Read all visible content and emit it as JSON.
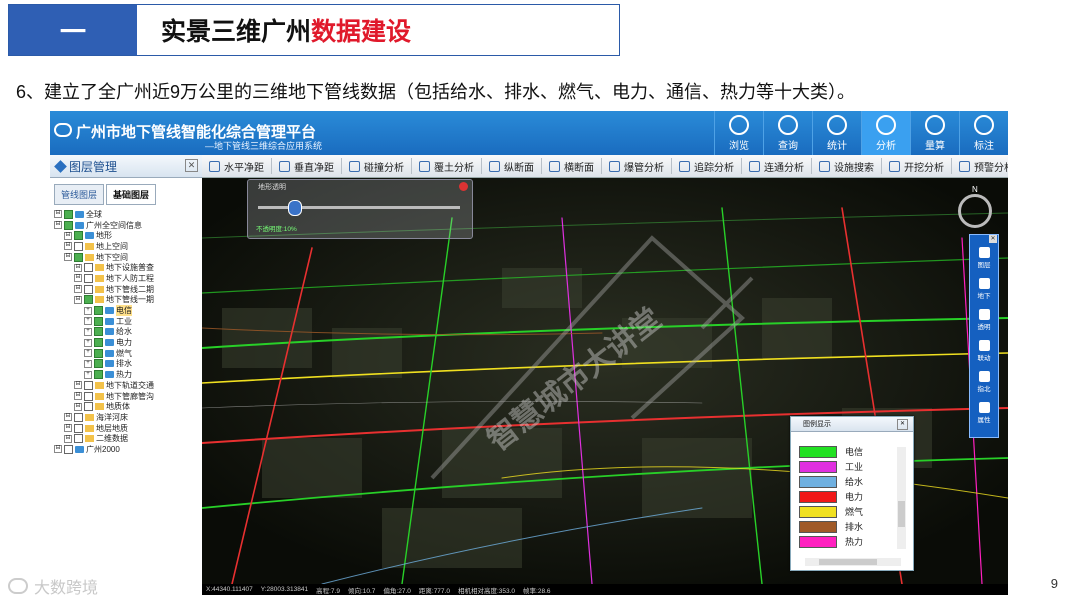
{
  "slide": {
    "section_number": "一",
    "title_plain": "实景三维广州",
    "title_highlight": "数据建设",
    "description": "6、建立了全广州近9万公里的三维地下管线数据（包括给水、排水、燃气、电力、通信、热力等十大类）。",
    "page_number": "9",
    "brand": "大数跨境"
  },
  "app": {
    "title": "广州市地下管线智能化综合管理平台",
    "subtitle": "地下管线三维综合应用系统",
    "top_tools": [
      {
        "label": "浏览",
        "icon": "target-icon"
      },
      {
        "label": "查询",
        "icon": "query-icon"
      },
      {
        "label": "统计",
        "icon": "chart-icon"
      },
      {
        "label": "分析",
        "icon": "analysis-icon"
      },
      {
        "label": "量算",
        "icon": "ruler-icon"
      },
      {
        "label": "标注",
        "icon": "pin-icon"
      }
    ],
    "toolbar": [
      "水平净距",
      "垂直净距",
      "碰撞分析",
      "覆土分析",
      "纵断面",
      "横断面",
      "爆管分析",
      "追踪分析",
      "连通分析",
      "设施搜索",
      "开挖分析",
      "预警分析"
    ],
    "toolbar_more": "▶▶",
    "layer_panel": {
      "title": "图层管理",
      "tabs": [
        "管线图层",
        "基础图层"
      ],
      "tree": [
        {
          "label": "全球",
          "level": 0,
          "checked": true,
          "icon": "layer"
        },
        {
          "label": "广州全空间信息",
          "level": 0,
          "checked": true,
          "icon": "layer"
        },
        {
          "label": "地形",
          "level": 1,
          "checked": true,
          "icon": "layer"
        },
        {
          "label": "地上空间",
          "level": 1,
          "checked": false,
          "icon": "folder"
        },
        {
          "label": "地下空间",
          "level": 1,
          "checked": true,
          "icon": "folder"
        },
        {
          "label": "地下设施普查",
          "level": 2,
          "checked": false,
          "icon": "folder"
        },
        {
          "label": "地下人防工程",
          "level": 2,
          "checked": false,
          "icon": "folder"
        },
        {
          "label": "地下管线二期",
          "level": 2,
          "checked": false,
          "icon": "folder"
        },
        {
          "label": "地下管线一期",
          "level": 2,
          "checked": true,
          "icon": "folder"
        },
        {
          "label": "电信",
          "level": 3,
          "checked": true,
          "icon": "layer",
          "selected": true
        },
        {
          "label": "工业",
          "level": 3,
          "checked": true,
          "icon": "layer"
        },
        {
          "label": "给水",
          "level": 3,
          "checked": true,
          "icon": "layer"
        },
        {
          "label": "电力",
          "level": 3,
          "checked": true,
          "icon": "layer"
        },
        {
          "label": "燃气",
          "level": 3,
          "checked": true,
          "icon": "layer"
        },
        {
          "label": "排水",
          "level": 3,
          "checked": true,
          "icon": "layer"
        },
        {
          "label": "热力",
          "level": 3,
          "checked": true,
          "icon": "layer"
        },
        {
          "label": "地下轨道交通",
          "level": 2,
          "checked": false,
          "icon": "folder"
        },
        {
          "label": "地下管廊管沟",
          "level": 2,
          "checked": false,
          "icon": "folder"
        },
        {
          "label": "地质体",
          "level": 2,
          "checked": false,
          "icon": "folder"
        },
        {
          "label": "海洋河床",
          "level": 1,
          "checked": false,
          "icon": "folder"
        },
        {
          "label": "地层地质",
          "level": 1,
          "checked": false,
          "icon": "folder"
        },
        {
          "label": "二维数据",
          "level": 1,
          "checked": false,
          "icon": "folder"
        },
        {
          "label": "广州2000",
          "level": 0,
          "checked": false,
          "icon": "layer"
        }
      ]
    },
    "transparency": {
      "title": "地形透明",
      "label": "不透明度:10%",
      "level_percent": 10
    },
    "right_tools": [
      "图层",
      "地下",
      "透明",
      "联动",
      "指北",
      "属性"
    ],
    "compass_label": "N",
    "legend": {
      "title": "图例显示",
      "items": [
        {
          "label": "电信",
          "color": "#22e022"
        },
        {
          "label": "工业",
          "color": "#e030e0"
        },
        {
          "label": "给水",
          "color": "#6fb0e0"
        },
        {
          "label": "电力",
          "color": "#f01818"
        },
        {
          "label": "燃气",
          "color": "#f0e020"
        },
        {
          "label": "排水",
          "color": "#a05a28"
        },
        {
          "label": "热力",
          "color": "#ff20c0"
        }
      ]
    },
    "watermark": "智慧城市大讲堂",
    "status": [
      "X:44340.111407",
      "Y:28003.313841",
      "高程:7.9",
      "倾向:10.7",
      "偏角:27.0",
      "距离:777.0",
      "相机相对高度:353.0",
      "帧率:28.6"
    ]
  },
  "colors": {
    "header_blue": "#2f5fb4",
    "highlight_red": "#e0192b",
    "app_blue": "#1a6cbf"
  }
}
